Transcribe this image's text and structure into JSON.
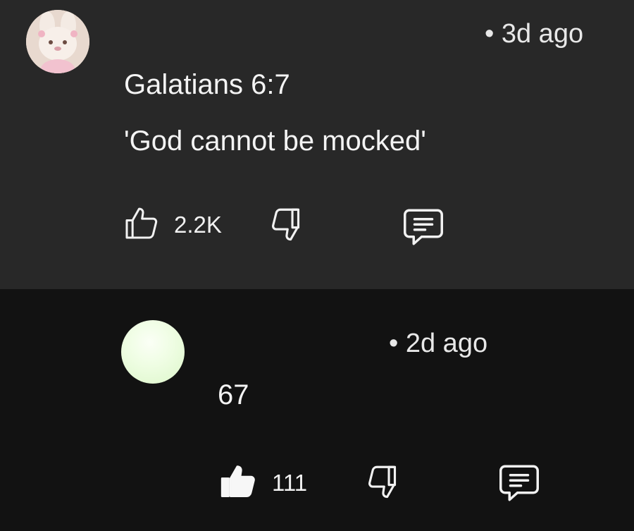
{
  "comments": [
    {
      "timestamp": "• 3d ago",
      "lines": [
        "Galatians 6:7",
        "'God cannot be mocked'"
      ],
      "like_count": "2.2K",
      "liked": false
    },
    {
      "timestamp": "• 2d ago",
      "lines": [
        "67"
      ],
      "like_count": "111",
      "liked": true
    }
  ],
  "icons": {
    "like": "thumbs-up-icon",
    "dislike": "thumbs-down-icon",
    "reply": "reply-comment-icon"
  },
  "colors": {
    "card_bg": "#282828",
    "page_bg": "#121212",
    "text": "#f1f1f1"
  }
}
